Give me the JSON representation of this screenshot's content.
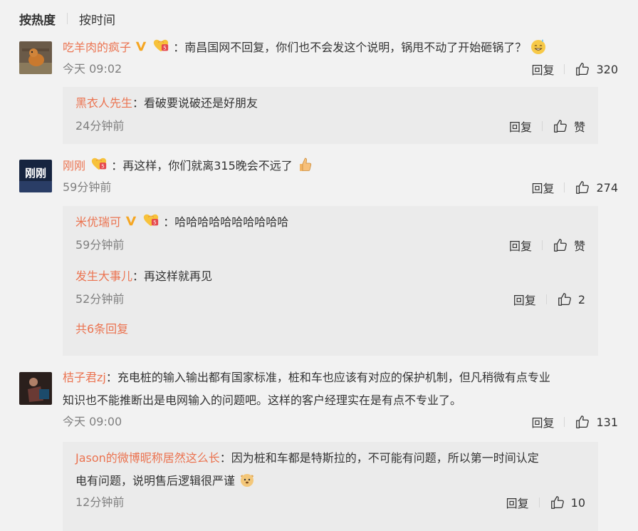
{
  "sort": {
    "hot": "按热度",
    "time": "按时间"
  },
  "comments": [
    {
      "user": "吃羊肉的疯子",
      "text": "：南昌国网不回复，你们也不会发这个说明，锅甩不动了开始砸锅了？",
      "time": "今天 09:02",
      "reply": "回复",
      "likes": "320",
      "replies": [
        {
          "user": "黑衣人先生",
          "text": "：看破要说破还是好朋友",
          "time": "24分钟前",
          "reply": "回复",
          "likes": "赞"
        }
      ]
    },
    {
      "user": "刚刚",
      "text": "：再这样，你们就离315晚会不远了",
      "time": "59分钟前",
      "reply": "回复",
      "likes": "274",
      "avatar_text": "刚刚",
      "replies": [
        {
          "user": "米优瑞可",
          "text": "：哈哈哈哈哈哈哈哈哈哈",
          "time": "59分钟前",
          "reply": "回复",
          "likes": "赞"
        },
        {
          "user": "发生大事儿",
          "text": "：再这样就再见",
          "time": "52分钟前",
          "reply": "回复",
          "likes": "2"
        }
      ],
      "more": "共6条回复"
    },
    {
      "user": "桔子君zj",
      "text": "：充电桩的输入输出都有国家标准，桩和车也应该有对应的保护机制，但凡稍微有点专业",
      "text2": "知识也不能推断出是电网输入的问题吧。这样的客户经理实在是有点不专业了。",
      "time": "今天 09:00",
      "reply": "回复",
      "likes": "131",
      "replies": [
        {
          "user": "Jason的微博昵称居然这么长",
          "text": "：因为桩和车都是特斯拉的，不可能有问题，所以第一时间认定",
          "text2": "电有问题，说明售后逻辑很严谨",
          "time": "12分钟前",
          "reply": "回复",
          "likes": "10"
        }
      ]
    }
  ],
  "icons": {
    "like": "thumb-up-icon",
    "verified": "orange-v-icon",
    "fan": "fan-badge-icon"
  },
  "colors": {
    "username": "#eb7350",
    "meta": "#808080",
    "subbg": "#ebebeb",
    "bg": "#f2f2f2"
  }
}
